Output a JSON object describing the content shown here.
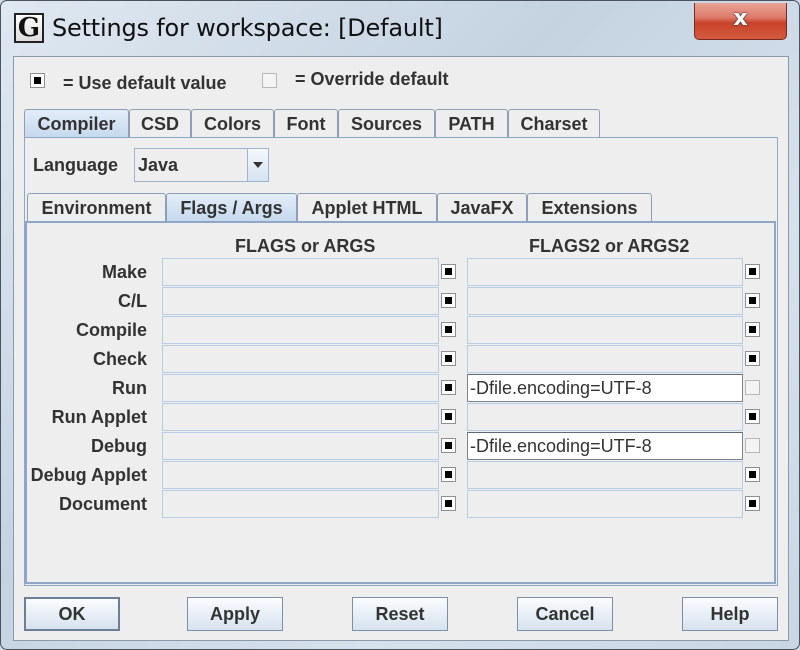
{
  "window": {
    "title": "Settings for workspace: [Default]",
    "app_icon_glyph": "G",
    "close_glyph": "x"
  },
  "legend": {
    "default_label": "= Use default value",
    "override_label": "= Override default"
  },
  "top_tabs": [
    {
      "label": "Compiler",
      "selected": true
    },
    {
      "label": "CSD",
      "selected": false
    },
    {
      "label": "Colors",
      "selected": false
    },
    {
      "label": "Font",
      "selected": false
    },
    {
      "label": "Sources",
      "selected": false
    },
    {
      "label": "PATH",
      "selected": false
    },
    {
      "label": "Charset",
      "selected": false
    }
  ],
  "language": {
    "label": "Language",
    "value": "Java"
  },
  "sub_tabs": [
    {
      "label": "Environment",
      "selected": false
    },
    {
      "label": "Flags / Args",
      "selected": true
    },
    {
      "label": "Applet HTML",
      "selected": false
    },
    {
      "label": "JavaFX",
      "selected": false
    },
    {
      "label": "Extensions",
      "selected": false
    }
  ],
  "flags": {
    "col1_header": "FLAGS or ARGS",
    "col2_header": "FLAGS2 or ARGS2",
    "rows": [
      {
        "label": "Make",
        "args": "",
        "args_default": true,
        "args2": "",
        "args2_default": true
      },
      {
        "label": "C/L",
        "args": "",
        "args_default": true,
        "args2": "",
        "args2_default": true
      },
      {
        "label": "Compile",
        "args": "",
        "args_default": true,
        "args2": "",
        "args2_default": true
      },
      {
        "label": "Check",
        "args": "",
        "args_default": true,
        "args2": "",
        "args2_default": true
      },
      {
        "label": "Run",
        "args": "",
        "args_default": true,
        "args2": "-Dfile.encoding=UTF-8",
        "args2_default": false
      },
      {
        "label": "Run Applet",
        "args": "",
        "args_default": true,
        "args2": "",
        "args2_default": true
      },
      {
        "label": "Debug",
        "args": "",
        "args_default": true,
        "args2": "-Dfile.encoding=UTF-8",
        "args2_default": false
      },
      {
        "label": "Debug Applet",
        "args": "",
        "args_default": true,
        "args2": "",
        "args2_default": true
      },
      {
        "label": "Document",
        "args": "",
        "args_default": true,
        "args2": "",
        "args2_default": true
      }
    ]
  },
  "buttons": {
    "ok": "OK",
    "apply": "Apply",
    "reset": "Reset",
    "cancel": "Cancel",
    "help": "Help"
  }
}
